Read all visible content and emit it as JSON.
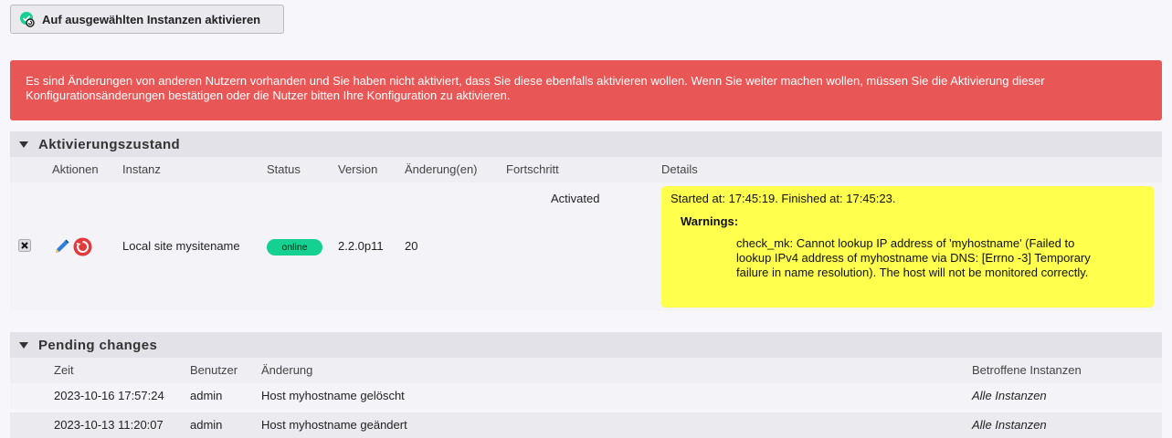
{
  "toolbar": {
    "activate_label": "Auf ausgewählten Instanzen aktivieren"
  },
  "error": {
    "message": "Es sind Änderungen von anderen Nutzern vorhanden und Sie haben nicht aktiviert, dass Sie diese ebenfalls aktivieren wollen. Wenn Sie weiter machen wollen, müssen Sie die Aktivierung dieser Konfigurationsänderungen bestätigen oder die Nutzer bitten Ihre Konfiguration zu aktivieren."
  },
  "activation": {
    "title": "Aktivierungszustand",
    "columns": {
      "actions": "Aktionen",
      "instance": "Instanz",
      "status": "Status",
      "version": "Version",
      "changes": "Änderung(en)",
      "progress": "Fortschritt",
      "details": "Details"
    },
    "row": {
      "instance": "Local site mysitename",
      "status": "online",
      "version": "2.2.0p11",
      "changes": "20",
      "progress": "Activated",
      "started": "Started at: 17:45:19. Finished at: 17:45:23.",
      "warnings_title": "Warnings:",
      "warning_text": "check_mk: Cannot lookup IP address of 'myhostname' (Failed to lookup IPv4 address of myhostname via DNS: [Errno -3] Temporary failure in name resolution). The host will not be monitored correctly."
    }
  },
  "pending": {
    "title": "Pending changes",
    "columns": {
      "time": "Zeit",
      "user": "Benutzer",
      "change": "Änderung",
      "affected": "Betroffene Instanzen"
    },
    "rows": [
      {
        "time": "2023-10-16 17:57:24",
        "user": "admin",
        "change": "Host myhostname gelöscht",
        "affected": "Alle Instanzen"
      },
      {
        "time": "2023-10-13 11:20:07",
        "user": "admin",
        "change": "Host myhostname geändert",
        "affected": "Alle Instanzen"
      }
    ]
  },
  "icons": {
    "activate": "activate-check-icon",
    "toggle_site": "checkbox-x-icon",
    "edit": "pencil-icon",
    "restart": "restart-icon",
    "collapse": "triangle-down-icon"
  },
  "colors": {
    "error_bg": "#e85656",
    "online": "#14d191",
    "warning_bg": "#ffff4d"
  }
}
